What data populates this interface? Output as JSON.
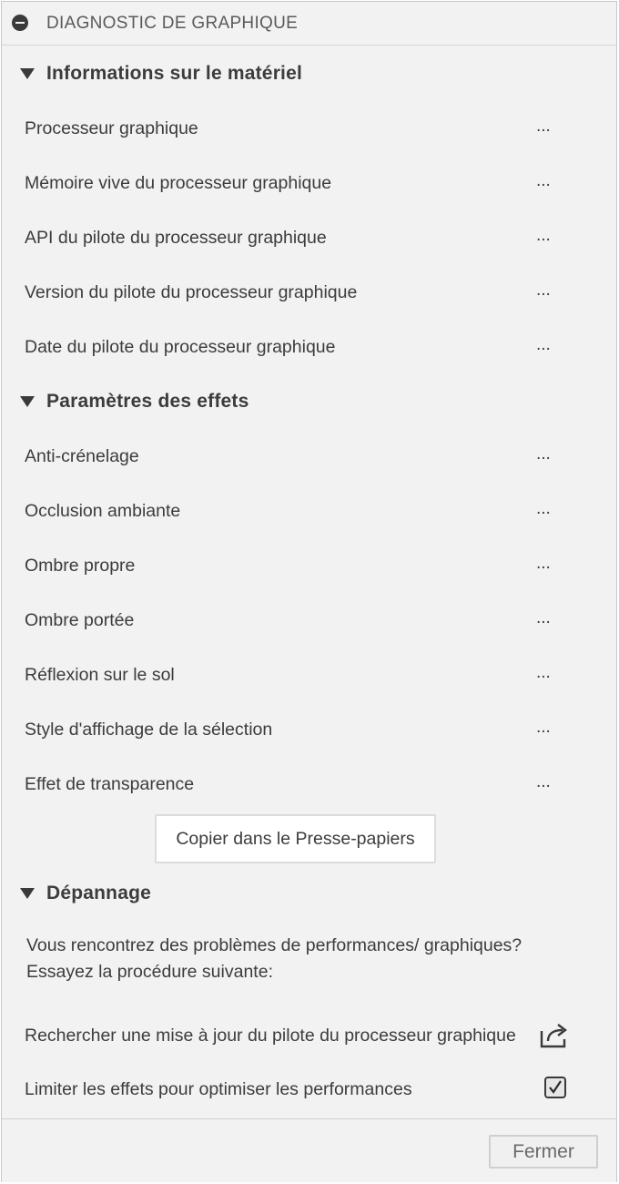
{
  "panel": {
    "title": "DIAGNOSTIC DE GRAPHIQUE",
    "collapse_icon": "minus-circle-icon"
  },
  "sections": {
    "hardware": {
      "title": "Informations sur le matériel",
      "rows": [
        {
          "label": "Processeur graphique",
          "value": "..."
        },
        {
          "label": "Mémoire vive du processeur graphique",
          "value": "..."
        },
        {
          "label": "API du pilote du processeur graphique",
          "value": "..."
        },
        {
          "label": "Version du pilote du processeur graphique",
          "value": "..."
        },
        {
          "label": "Date du pilote du processeur graphique",
          "value": "..."
        }
      ]
    },
    "effects": {
      "title": "Paramètres des effets",
      "rows": [
        {
          "label": "Anti-crénelage",
          "value": "..."
        },
        {
          "label": "Occlusion ambiante",
          "value": "..."
        },
        {
          "label": "Ombre propre",
          "value": "..."
        },
        {
          "label": "Ombre portée",
          "value": "..."
        },
        {
          "label": "Réflexion sur le sol",
          "value": "..."
        },
        {
          "label": "Style d'affichage de la sélection",
          "value": "..."
        },
        {
          "label": "Effet de transparence",
          "value": "..."
        }
      ],
      "copy_button": "Copier dans le Presse-papiers"
    },
    "troubleshooting": {
      "title": "Dépannage",
      "description": "Vous rencontrez des problèmes de performances/ graphiques? Essayez la procédure suivante:",
      "update_link": "Rechercher une mise à jour du pilote du processeur graphique",
      "update_icon": "external-link-icon",
      "limit_effects_label": "Limiter les effets pour optimiser les performances",
      "limit_effects_checked": true
    }
  },
  "footer": {
    "close_button": "Fermer"
  }
}
